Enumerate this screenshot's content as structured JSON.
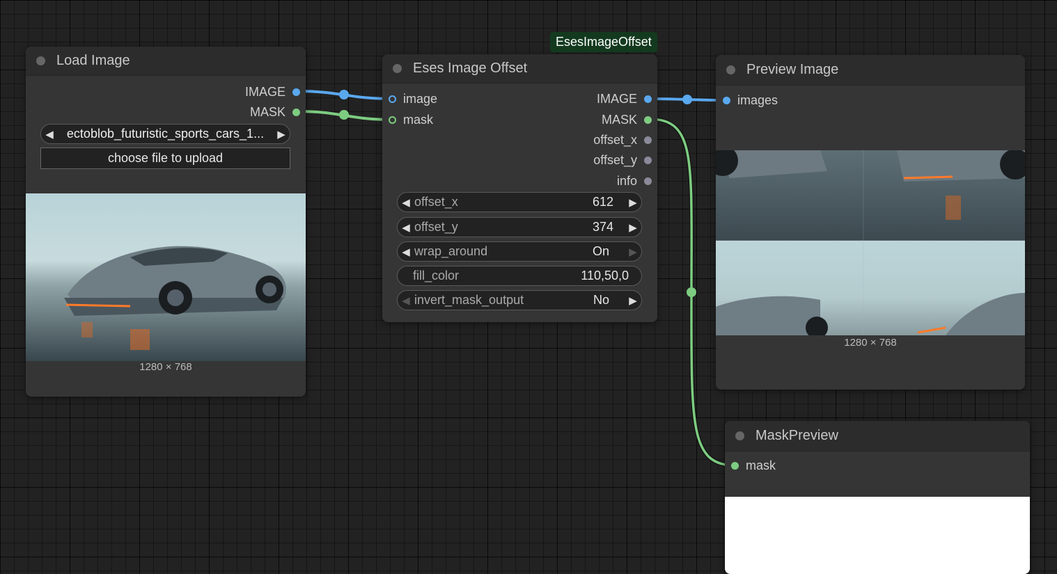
{
  "nodes": {
    "load_image": {
      "title": "Load Image",
      "outputs": [
        "IMAGE",
        "MASK"
      ],
      "file_combo": "ectoblob_futuristic_sports_cars_1...",
      "upload_label": "choose file to upload",
      "dimensions": "1280 × 768"
    },
    "offset": {
      "badge": "EsesImageOffset",
      "title": "Eses Image Offset",
      "inputs": [
        "image",
        "mask"
      ],
      "outputs": [
        "IMAGE",
        "MASK",
        "offset_x",
        "offset_y",
        "info"
      ],
      "widgets": [
        {
          "label": "offset_x",
          "value": "612"
        },
        {
          "label": "offset_y",
          "value": "374"
        },
        {
          "label": "wrap_around",
          "value": "On"
        },
        {
          "label": "fill_color",
          "value": "110,50,0"
        },
        {
          "label": "invert_mask_output",
          "value": "No"
        }
      ]
    },
    "preview": {
      "title": "Preview Image",
      "input": "images",
      "dimensions": "1280 × 768"
    },
    "mask_preview": {
      "title": "MaskPreview",
      "input": "mask"
    }
  },
  "colors": {
    "image_link": "#5aa8ee",
    "mask_link": "#7dcc81",
    "badge_bg": "#133a1f"
  }
}
